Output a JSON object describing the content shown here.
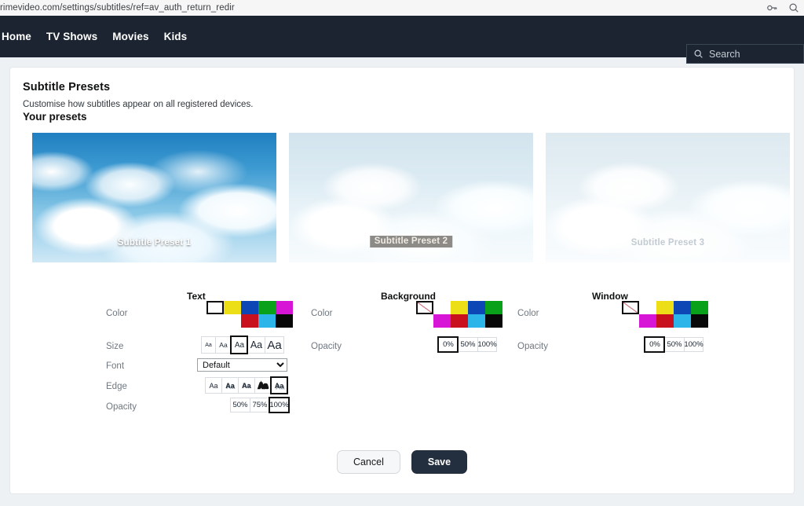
{
  "browser": {
    "url": "rimevideo.com/settings/subtitles/ref=av_auth_return_redir",
    "icons": [
      "key-icon",
      "search-icon"
    ]
  },
  "site_nav": {
    "links": [
      {
        "label": "Home"
      },
      {
        "label": "TV Shows"
      },
      {
        "label": "Movies"
      },
      {
        "label": "Kids"
      }
    ],
    "search": {
      "placeholder": "Search",
      "value": "",
      "icon": "search-icon"
    }
  },
  "page": {
    "title": "Subtitle Presets",
    "subtitle": "Customise how subtitles appear on all registered devices.",
    "presets_heading": "Your presets"
  },
  "presets": [
    {
      "label": "Subtitle Preset 1"
    },
    {
      "label": "Subtitle Preset 2"
    },
    {
      "label": "Subtitle Preset 3"
    }
  ],
  "text_section": {
    "heading": "Text",
    "labels": {
      "color": "Color",
      "size": "Size",
      "font": "Font",
      "edge": "Edge",
      "opacity": "Opacity"
    },
    "colors": {
      "row1": [
        {
          "name": "white",
          "hex": "#ffffff",
          "selected": true
        },
        {
          "name": "yellow",
          "hex": "#ecdf18",
          "selected": false
        },
        {
          "name": "blue",
          "hex": "#0d47b5",
          "selected": false
        },
        {
          "name": "green",
          "hex": "#09a01a",
          "selected": false
        },
        {
          "name": "magenta",
          "hex": "#d715d7",
          "selected": false
        }
      ],
      "row2": [
        {
          "name": "spacer",
          "hex": "",
          "selected": false
        },
        {
          "name": "spacer",
          "hex": "",
          "selected": false
        },
        {
          "name": "red",
          "hex": "#c8111c",
          "selected": false
        },
        {
          "name": "cyan",
          "hex": "#2cb5e8",
          "selected": false
        },
        {
          "name": "black",
          "hex": "#080808",
          "selected": false
        }
      ]
    },
    "sizes": [
      {
        "label": "Aa",
        "selected": false
      },
      {
        "label": "Aa",
        "selected": false
      },
      {
        "label": "Aa",
        "selected": true
      },
      {
        "label": "Aa",
        "selected": false
      },
      {
        "label": "Aa",
        "selected": false
      }
    ],
    "font": {
      "selected": "Default",
      "options": [
        "Default"
      ]
    },
    "edges": [
      {
        "label": "Aa",
        "style": "none",
        "selected": false
      },
      {
        "label": "Aa",
        "style": "raised",
        "selected": false
      },
      {
        "label": "Aa",
        "style": "depress",
        "selected": false
      },
      {
        "label": "Aa",
        "style": "uniform",
        "selected": false
      },
      {
        "label": "Aa",
        "style": "shadow",
        "selected": true
      }
    ],
    "opacity": [
      {
        "label": "50%",
        "selected": false
      },
      {
        "label": "75%",
        "selected": false
      },
      {
        "label": "100%",
        "selected": true
      }
    ]
  },
  "background_section": {
    "heading": "Background",
    "labels": {
      "color": "Color",
      "opacity": "Opacity"
    },
    "colors": {
      "row1": [
        {
          "name": "none",
          "hex": "",
          "selected": true
        },
        {
          "name": "white",
          "hex": "#ffffff",
          "selected": false
        },
        {
          "name": "yellow",
          "hex": "#ecdf18",
          "selected": false
        },
        {
          "name": "blue",
          "hex": "#0d47b5",
          "selected": false
        },
        {
          "name": "green",
          "hex": "#09a01a",
          "selected": false
        }
      ],
      "row2": [
        {
          "name": "spacer",
          "hex": "",
          "selected": false
        },
        {
          "name": "magenta",
          "hex": "#d715d7",
          "selected": false
        },
        {
          "name": "red",
          "hex": "#c8111c",
          "selected": false
        },
        {
          "name": "cyan",
          "hex": "#2cb5e8",
          "selected": false
        },
        {
          "name": "black",
          "hex": "#080808",
          "selected": false
        }
      ]
    },
    "opacity": [
      {
        "label": "0%",
        "selected": true
      },
      {
        "label": "50%",
        "selected": false
      },
      {
        "label": "100%",
        "selected": false
      }
    ]
  },
  "window_section": {
    "heading": "Window",
    "labels": {
      "color": "Color",
      "opacity": "Opacity"
    },
    "colors": {
      "row1": [
        {
          "name": "none",
          "hex": "",
          "selected": true
        },
        {
          "name": "white",
          "hex": "#ffffff",
          "selected": false
        },
        {
          "name": "yellow",
          "hex": "#ecdf18",
          "selected": false
        },
        {
          "name": "blue",
          "hex": "#0d47b5",
          "selected": false
        },
        {
          "name": "green",
          "hex": "#09a01a",
          "selected": false
        }
      ],
      "row2": [
        {
          "name": "spacer",
          "hex": "",
          "selected": false
        },
        {
          "name": "magenta",
          "hex": "#d715d7",
          "selected": false
        },
        {
          "name": "red",
          "hex": "#c8111c",
          "selected": false
        },
        {
          "name": "cyan",
          "hex": "#2cb5e8",
          "selected": false
        },
        {
          "name": "black",
          "hex": "#080808",
          "selected": false
        }
      ]
    },
    "opacity": [
      {
        "label": "0%",
        "selected": true
      },
      {
        "label": "50%",
        "selected": false
      },
      {
        "label": "100%",
        "selected": false
      }
    ]
  },
  "footer": {
    "cancel_label": "Cancel",
    "save_label": "Save"
  },
  "theme": {
    "nav_background": "#1b2430",
    "save_button": "#232f3e",
    "page_background": "#eef1f4"
  }
}
